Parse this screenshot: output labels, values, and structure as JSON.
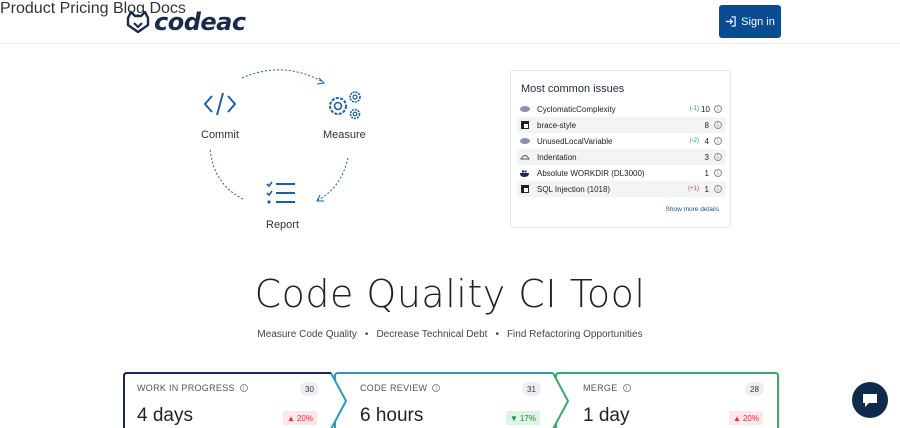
{
  "header": {
    "brand": "codeac",
    "nav": [
      {
        "label": "Product"
      },
      {
        "label": "Pricing"
      },
      {
        "label": "Blog"
      },
      {
        "label": "Docs"
      }
    ],
    "signin_label": "Sign in"
  },
  "cycle": {
    "commit_label": "Commit",
    "measure_label": "Measure",
    "report_label": "Report",
    "accent": "#1c5fa8"
  },
  "issues": {
    "title": "Most common issues",
    "rows": [
      {
        "icon": "php-icon",
        "name": "CyclomaticComplexity",
        "delta": "(-1)",
        "delta_color": "green",
        "count": "10"
      },
      {
        "icon": "eslint-icon",
        "name": "brace-style",
        "delta": "",
        "delta_color": "",
        "count": "8"
      },
      {
        "icon": "php-icon",
        "name": "UnusedLocalVariable",
        "delta": "(-2)",
        "delta_color": "green",
        "count": "4"
      },
      {
        "icon": "stylelint-icon",
        "name": "Indentation",
        "delta": "",
        "delta_color": "",
        "count": "3"
      },
      {
        "icon": "docker-icon",
        "name": "Absolute WORKDIR (DL3000)",
        "delta": "",
        "delta_color": "",
        "count": "1"
      },
      {
        "icon": "eslint-icon",
        "name": "SQL Injection (1018)",
        "delta": "(+1)",
        "delta_color": "red",
        "count": "1"
      }
    ],
    "show_more": "Show more details"
  },
  "hero": {
    "title": "Code Quality CI Tool",
    "sub": [
      "Measure Code Quality",
      "Decrease Technical Debt",
      "Find Refactoring Opportunities"
    ],
    "separator": "•"
  },
  "metrics": [
    {
      "label": "WORK IN PROGRESS",
      "count": "30",
      "value": "4 days",
      "badge": "20%",
      "trend": "up",
      "border": "#1b2a4a"
    },
    {
      "label": "CODE REVIEW",
      "count": "31",
      "value": "6 hours",
      "badge": "17%",
      "trend": "down",
      "border": "#2a9bb0"
    },
    {
      "label": "MERGE",
      "count": "28",
      "value": "1 day",
      "badge": "20%",
      "trend": "up",
      "border": "#3aaa6a"
    }
  ],
  "colors": {
    "brand": "#0b4b91",
    "nav": "#1c4f8f",
    "up": "#d9363e",
    "down": "#1e8a45"
  },
  "chat": {
    "icon": "chat-icon"
  }
}
